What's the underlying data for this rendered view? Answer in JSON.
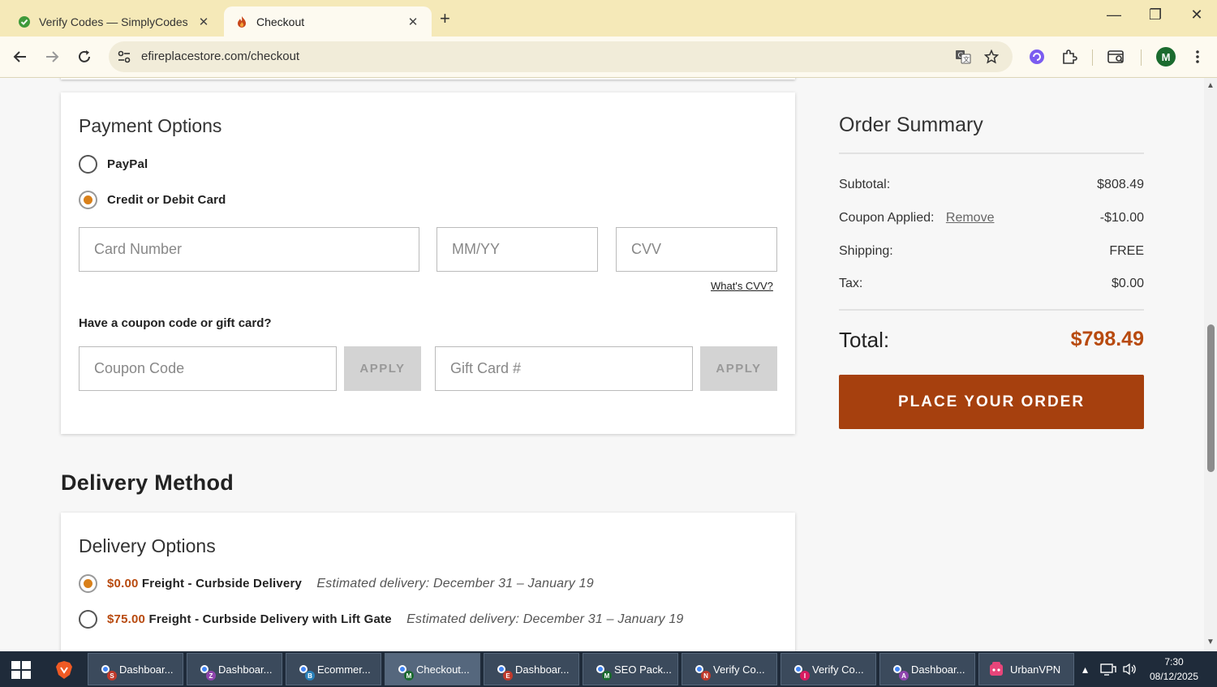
{
  "browser": {
    "tabs": [
      {
        "title": "Verify Codes — SimplyCodes",
        "icon": "simplycodes-icon"
      },
      {
        "title": "Checkout",
        "icon": "flame-icon"
      }
    ],
    "url": "efireplacestore.com/checkout",
    "profile_initial": "M"
  },
  "payment": {
    "heading": "Payment Options",
    "options": [
      {
        "label": "PayPal",
        "selected": false
      },
      {
        "label": "Credit or Debit Card",
        "selected": true
      }
    ],
    "card_number_placeholder": "Card Number",
    "expiry_placeholder": "MM/YY",
    "cvv_placeholder": "CVV",
    "whats_cvv": "What's CVV?",
    "coupon_question": "Have a coupon code or gift card?",
    "coupon_placeholder": "Coupon Code",
    "gift_placeholder": "Gift Card #",
    "apply_label": "APPLY"
  },
  "delivery": {
    "section_title": "Delivery Method",
    "heading": "Delivery Options",
    "options": [
      {
        "price": "$0.00",
        "name": "Freight - Curbside Delivery",
        "estimate": "Estimated delivery: December 31 – January 19",
        "selected": true
      },
      {
        "price": "$75.00",
        "name": "Freight - Curbside Delivery with Lift Gate",
        "estimate": "Estimated delivery: December 31 – January 19",
        "selected": false
      }
    ]
  },
  "summary": {
    "title": "Order Summary",
    "subtotal_label": "Subtotal:",
    "subtotal": "$808.49",
    "coupon_label": "Coupon Applied:",
    "remove_label": "Remove",
    "coupon_value": "-$10.00",
    "shipping_label": "Shipping:",
    "shipping": "FREE",
    "tax_label": "Tax:",
    "tax": "$0.00",
    "total_label": "Total:",
    "total": "$798.49",
    "place_order": "PLACE YOUR ORDER",
    "accent_color": "#a6400e"
  },
  "taskbar": {
    "items": [
      {
        "label": "Dashboar...",
        "badge": "S",
        "badge_color": "#c0392b"
      },
      {
        "label": "Dashboar...",
        "badge": "Z",
        "badge_color": "#8e44ad"
      },
      {
        "label": "Ecommer...",
        "badge": "B",
        "badge_color": "#2980b9"
      },
      {
        "label": "Checkout...",
        "badge": "M",
        "badge_color": "#1b6b2f"
      },
      {
        "label": "Dashboar...",
        "badge": "E",
        "badge_color": "#c0392b"
      },
      {
        "label": "SEO Pack...",
        "badge": "M",
        "badge_color": "#1b6b2f"
      },
      {
        "label": "Verify Co...",
        "badge": "N",
        "badge_color": "#c0392b"
      },
      {
        "label": "Verify Co...",
        "badge": "I",
        "badge_color": "#d81b60"
      },
      {
        "label": "Dashboar...",
        "badge": "A",
        "badge_color": "#8e44ad"
      },
      {
        "label": "UrbanVPN",
        "badge": "",
        "badge_color": ""
      }
    ],
    "time": "7:30",
    "date": "08/12/2025"
  }
}
